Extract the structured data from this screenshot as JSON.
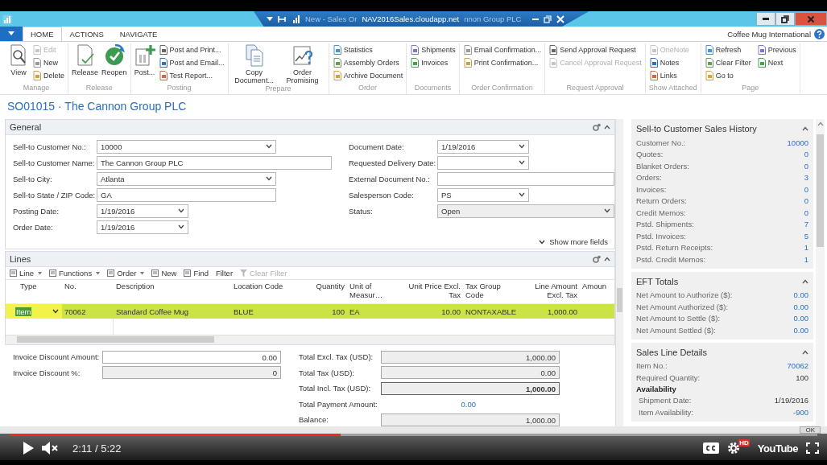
{
  "window": {
    "title_parts": [
      {
        "text": "New - Sales Or",
        "faded": true
      },
      {
        "text": "NAV2016Sales.cloudapp.net",
        "faded": false
      },
      {
        "text": "nnon Group PLC",
        "faded": true
      }
    ]
  },
  "ribbon": {
    "tabs": [
      {
        "label": "HOME",
        "selected": true
      },
      {
        "label": "ACTIONS",
        "selected": false
      },
      {
        "label": "NAVIGATE",
        "selected": false
      }
    ],
    "company": "Coffee Mug International",
    "groups": [
      {
        "label": "Manage",
        "items": [
          {
            "label": "View",
            "kind": "large",
            "disabled": false
          },
          {
            "label": "Edit",
            "kind": "small",
            "disabled": true
          },
          {
            "label": "New",
            "kind": "small",
            "disabled": false
          },
          {
            "label": "Delete",
            "kind": "small",
            "disabled": false
          }
        ]
      },
      {
        "label": "Release",
        "items": [
          {
            "label": "Release",
            "kind": "large",
            "disabled": false
          },
          {
            "label": "Reopen",
            "kind": "large",
            "disabled": false
          }
        ]
      },
      {
        "label": "Posting",
        "items": [
          {
            "label": "Post...",
            "kind": "large",
            "disabled": false
          },
          {
            "label": "Post and Print...",
            "kind": "small",
            "disabled": false
          },
          {
            "label": "Post and Email...",
            "kind": "small",
            "disabled": false
          },
          {
            "label": "Test Report...",
            "kind": "small",
            "disabled": false
          }
        ]
      },
      {
        "label": "Prepare",
        "items": [
          {
            "label": "Copy Document...",
            "kind": "large",
            "disabled": false
          },
          {
            "label": "Order Promising",
            "kind": "large",
            "disabled": false
          }
        ]
      },
      {
        "label": "Order",
        "items": [
          {
            "label": "Statistics",
            "kind": "small",
            "disabled": false
          },
          {
            "label": "Assembly Orders",
            "kind": "small",
            "disabled": false
          },
          {
            "label": "Archive Document",
            "kind": "small",
            "disabled": false
          }
        ]
      },
      {
        "label": "Documents",
        "items": [
          {
            "label": "Shipments",
            "kind": "small",
            "disabled": false
          },
          {
            "label": "Invoices",
            "kind": "small",
            "disabled": false
          }
        ]
      },
      {
        "label": "Order Confirmation",
        "items": [
          {
            "label": "Email Confirmation...",
            "kind": "small",
            "disabled": false
          },
          {
            "label": "Print Confirmation...",
            "kind": "small",
            "disabled": false
          }
        ]
      },
      {
        "label": "Request Approval",
        "items": [
          {
            "label": "Send Approval Request",
            "kind": "small",
            "disabled": false
          },
          {
            "label": "Cancel Approval Request",
            "kind": "small",
            "disabled": true
          }
        ]
      },
      {
        "label": "Show Attached",
        "items": [
          {
            "label": "OneNote",
            "kind": "small",
            "disabled": true
          },
          {
            "label": "Notes",
            "kind": "small",
            "disabled": false
          },
          {
            "label": "Links",
            "kind": "small",
            "disabled": false
          }
        ]
      },
      {
        "label": "Page",
        "items": [
          {
            "label": "Refresh",
            "kind": "small",
            "disabled": false
          },
          {
            "label": "Clear Filter",
            "kind": "small",
            "disabled": false
          },
          {
            "label": "Go to",
            "kind": "small",
            "disabled": false
          },
          {
            "label": "Previous",
            "kind": "small",
            "disabled": false
          },
          {
            "label": "Next",
            "kind": "small",
            "disabled": false
          }
        ]
      }
    ]
  },
  "page_title": "SO01015 · The Cannon Group PLC",
  "general": {
    "title": "General",
    "left_fields": [
      {
        "label": "Sell-to Customer No.:",
        "value": "10000",
        "kind": "dropdown",
        "disabled": false
      },
      {
        "label": "Sell-to Customer Name:",
        "value": "The Cannon Group PLC",
        "kind": "text",
        "disabled": false
      },
      {
        "label": "Sell-to City:",
        "value": "Atlanta",
        "kind": "dropdown",
        "disabled": false
      },
      {
        "label": "Sell-to State / ZIP Code:",
        "value": "GA",
        "kind": "text",
        "disabled": false
      },
      {
        "label": "Posting Date:",
        "value": "1/19/2016",
        "kind": "dropdown",
        "disabled": false
      },
      {
        "label": "Order Date:",
        "value": "1/19/2016",
        "kind": "dropdown",
        "disabled": false
      }
    ],
    "right_fields": [
      {
        "label": "Document Date:",
        "value": "1/19/2016",
        "kind": "dropdown",
        "disabled": false
      },
      {
        "label": "Requested Delivery Date:",
        "kind": "dropdown",
        "disabled": false
      },
      {
        "label": "External Document No.:",
        "kind": "text",
        "disabled": false
      },
      {
        "label": "Salesperson Code:",
        "value": "PS",
        "kind": "dropdown",
        "disabled": false
      },
      {
        "label": "Status:",
        "value": "Open",
        "kind": "dropdown",
        "disabled": true
      }
    ],
    "show_more": "Show more fields"
  },
  "lines": {
    "title": "Lines",
    "toolbar": [
      {
        "label": "Line",
        "menu": true,
        "disabled": false
      },
      {
        "label": "Functions",
        "menu": true,
        "disabled": false
      },
      {
        "label": "Order",
        "menu": true,
        "disabled": false
      },
      {
        "label": "New",
        "menu": false,
        "disabled": false
      },
      {
        "label": "Find",
        "menu": false,
        "disabled": false
      },
      {
        "label": "Filter",
        "menu": false,
        "disabled": false
      },
      {
        "label": "Clear Filter",
        "menu": false,
        "disabled": true
      }
    ],
    "columns": [
      "Type",
      "No.",
      "Description",
      "Location Code",
      "Quantity",
      "Unit of Measur…",
      "Unit Price Excl. Tax",
      "Tax Group Code",
      "Line Amount Excl. Tax",
      "Amoun"
    ],
    "rows": [
      {
        "selected": true,
        "cells": [
          "Item",
          "70062",
          "Standard Coffee Mug",
          "BLUE",
          "100",
          "EA",
          "10.00",
          "NONTAXABLE",
          "1,000.00"
        ]
      }
    ]
  },
  "totals": {
    "left": [
      {
        "label": "Invoice Discount Amount:",
        "value": "0.00",
        "editable": true
      },
      {
        "label": "Invoice Discount %:",
        "value": "0",
        "editable": false
      }
    ],
    "right": [
      {
        "label": "Total Excl. Tax (USD):",
        "value": "1,000.00",
        "kind": "box",
        "bold": false
      },
      {
        "label": "Total Tax (USD):",
        "value": "0.00",
        "kind": "box",
        "bold": false
      },
      {
        "label": "Total Incl. Tax (USD):",
        "value": "1,000.00",
        "kind": "box",
        "bold": true
      },
      {
        "label": "Total Payment Amount:",
        "value": "0.00",
        "kind": "link",
        "bold": false
      },
      {
        "label": "Balance:",
        "value": "1,000.00",
        "kind": "box",
        "bold": false
      }
    ]
  },
  "factboxes": [
    {
      "title": "Sell-to Customer Sales History",
      "rows": [
        {
          "kind": "row",
          "label": "Customer No.:",
          "value": "10000",
          "link": true
        },
        {
          "kind": "row",
          "label": "Quotes:",
          "value": "0",
          "link": true
        },
        {
          "kind": "row",
          "label": "Blanket Orders:",
          "value": "0",
          "link": true
        },
        {
          "kind": "row",
          "label": "Orders:",
          "value": "3",
          "link": true
        },
        {
          "kind": "row",
          "label": "Invoices:",
          "value": "0",
          "link": true
        },
        {
          "kind": "row",
          "label": "Return Orders:",
          "value": "0",
          "link": true
        },
        {
          "kind": "row",
          "label": "Credit Memos:",
          "value": "0",
          "link": true
        },
        {
          "kind": "row",
          "label": "Pstd. Shipments:",
          "value": "7",
          "link": true
        },
        {
          "kind": "row",
          "label": "Pstd. Invoices:",
          "value": "5",
          "link": true
        },
        {
          "kind": "row",
          "label": "Pstd. Return Receipts:",
          "value": "1",
          "link": true
        },
        {
          "kind": "row",
          "label": "Pstd. Credit Memos:",
          "value": "1",
          "link": true
        }
      ]
    },
    {
      "title": "EFT Totals",
      "rows": [
        {
          "kind": "row",
          "label": "Net Amount to Authorize ($):",
          "value": "0.00",
          "link": true
        },
        {
          "kind": "row",
          "label": "Net Amount Authorized ($):",
          "value": "0.00",
          "link": true
        },
        {
          "kind": "row",
          "label": "Net Amount to Settle ($):",
          "value": "0.00",
          "link": true
        },
        {
          "kind": "row",
          "label": "Net Amount Settled ($):",
          "value": "0.00",
          "link": true
        }
      ]
    },
    {
      "title": "Sales Line Details",
      "rows": [
        {
          "kind": "row",
          "label": "Item No.:",
          "value": "70062",
          "link": true
        },
        {
          "kind": "row",
          "label": "Required Quantity:",
          "value": "100",
          "link": false
        },
        {
          "kind": "heading",
          "label": "Availability"
        },
        {
          "kind": "row",
          "label": "Shipment Date:",
          "value": "1/19/2016",
          "link": false
        },
        {
          "kind": "row",
          "label": "Item Availability:",
          "value": "-900",
          "link": true
        }
      ]
    }
  ],
  "ok_button": "OK",
  "player": {
    "progress": {
      "level": 0.41
    },
    "time": "2:11 / 5:22",
    "hd_badge": "HD",
    "logo": "YouTube"
  }
}
